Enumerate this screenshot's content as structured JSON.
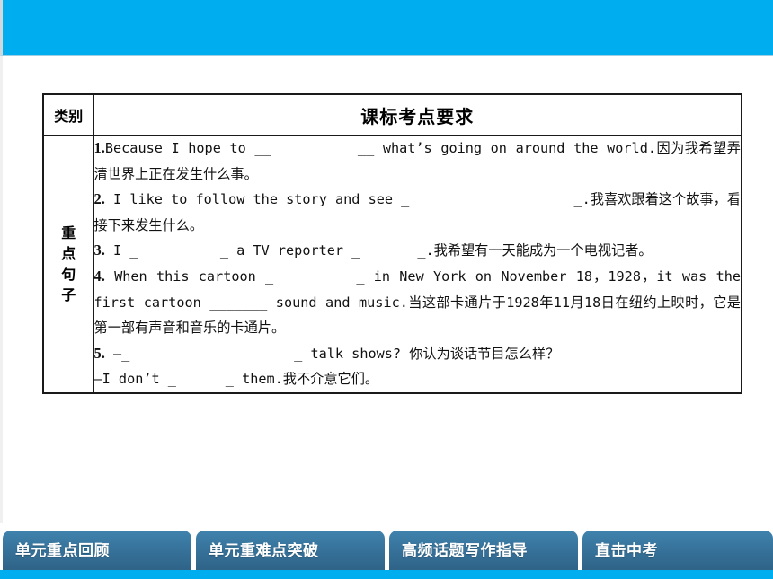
{
  "banner": {
    "color": "#00AEEF",
    "label": "top-blue-banner"
  },
  "table": {
    "header": {
      "category": "类别",
      "requirement": "课标考点要求"
    },
    "row": {
      "category_vertical": [
        "重",
        "点",
        "句",
        "子"
      ],
      "category_plain": "重点句子",
      "items": [
        {
          "number": "1.",
          "text": "Because I hope to __          __ what’s going on around the world.因为我希望弄清世界上正在发生什么事。"
        },
        {
          "number": "2.",
          "text": " I like to follow the story and see _                    _.我喜欢跟着这个故事，看接下来发生什么。"
        },
        {
          "number": "3.",
          "text": " I _          _ a TV reporter _       _.我希望有一天能成为一个电视记者。"
        },
        {
          "number": "4.",
          "text": " When this cartoon _         _ in New York on November 18，1928，it was the first cartoon _______ sound and music.当这部卡通片于1928年11月18日在纽约上映时，它是第一部有声音和音乐的卡通片。"
        },
        {
          "number": "5.",
          "text": " —_                    _ talk shows? 你认为谈话节目怎么样？\n—I don’t _      _ them.我不介意它们。"
        }
      ]
    }
  },
  "tabs": [
    {
      "label": "单元重点回顾"
    },
    {
      "label": "单元重难点突破"
    },
    {
      "label": "高频话题写作指导"
    },
    {
      "label": "直击中考"
    }
  ],
  "colors": {
    "banner_blue": "#00AEEF",
    "tab_blue": "#356f97",
    "table_border": "#1a1a1a",
    "text": "#111111"
  }
}
